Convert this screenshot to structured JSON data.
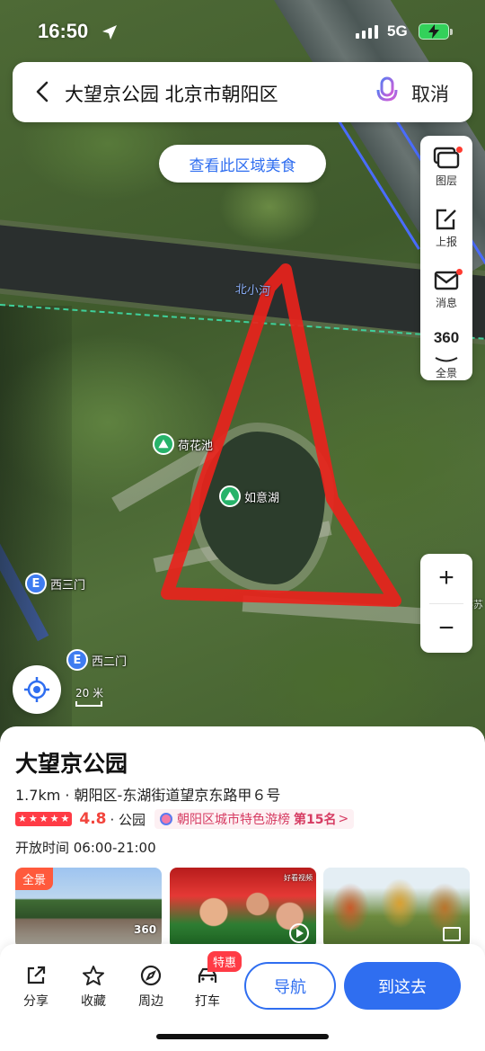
{
  "status_bar": {
    "time": "16:50",
    "network": "5G"
  },
  "search": {
    "query": "大望京公园 北京市朝阳区",
    "cancel_label": "取消"
  },
  "map": {
    "food_pill_label": "查看此区域美食",
    "canal_label": "北小河",
    "pois": [
      {
        "label": "荷花池",
        "type": "scenic"
      },
      {
        "label": "如意湖",
        "type": "scenic"
      },
      {
        "label": "西三门",
        "type": "entrance"
      },
      {
        "label": "西二门",
        "type": "entrance"
      }
    ],
    "edge_label": "察苏",
    "scale_label": "20 米",
    "highlight_color": "#e8231c"
  },
  "side_tools": [
    {
      "label": "图层",
      "icon": "layers-icon",
      "badge": true
    },
    {
      "label": "上报",
      "icon": "report-icon",
      "badge": false
    },
    {
      "label": "消息",
      "icon": "message-icon",
      "badge": true
    },
    {
      "label": "全景",
      "icon": "panorama-360-icon",
      "badge": false,
      "glyph": "360"
    }
  ],
  "zoom": {
    "in": "+",
    "out": "−"
  },
  "place": {
    "name": "大望京公园",
    "address": "1.7km · 朝阳区-东湖街道望京东路甲６号",
    "rating": 4.8,
    "stars": 5,
    "category": "· 公园",
    "ranking_text": "朝阳区城市特色游榜",
    "ranking_position": "第15名",
    "hours": "开放时间 06:00-21:00"
  },
  "photos": {
    "panorama_badge": "全景",
    "panorama_tag": "360",
    "video_source_tag": "好看视频"
  },
  "actions": [
    {
      "label": "分享",
      "icon": "share-icon"
    },
    {
      "label": "收藏",
      "icon": "star-icon"
    },
    {
      "label": "周边",
      "icon": "compass-icon"
    },
    {
      "label": "打车",
      "icon": "taxi-icon"
    }
  ],
  "promo_badge": "特惠",
  "buttons": {
    "navigate": "导航",
    "go_here": "到这去"
  },
  "colors": {
    "accent": "#2f6ef0",
    "rating": "#f2453d",
    "promo": "#ff3b45"
  }
}
